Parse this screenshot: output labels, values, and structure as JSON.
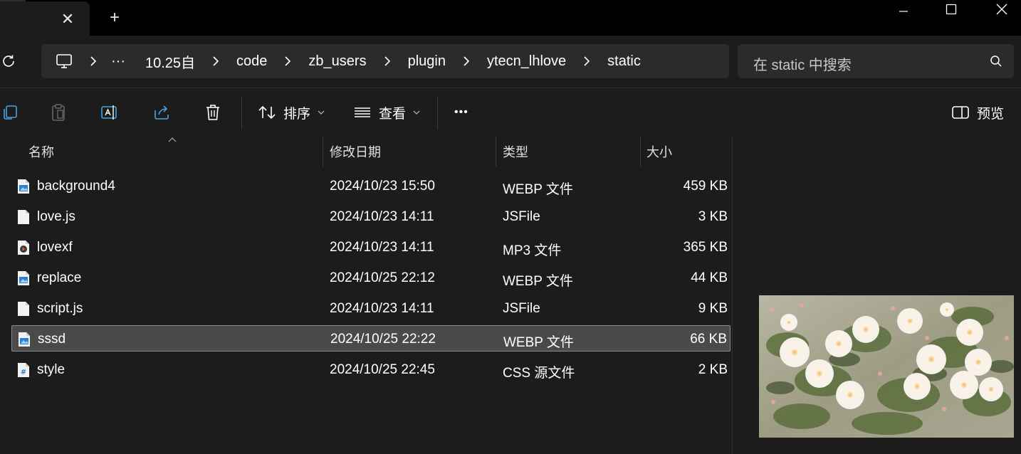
{
  "window": {
    "tab_close_glyph": "✕",
    "new_tab_glyph": "+",
    "minimize_glyph": "—",
    "close_glyph": "✕"
  },
  "breadcrumb": {
    "overflow": "···",
    "items": [
      "10.25自",
      "code",
      "zb_users",
      "plugin",
      "ytecn_lhlove",
      "static"
    ]
  },
  "search": {
    "placeholder": "在 static 中搜索"
  },
  "toolbar": {
    "sort_label": "排序",
    "view_label": "查看",
    "more_glyph": "•••",
    "preview_label": "预览"
  },
  "columns": {
    "name": "名称",
    "date": "修改日期",
    "type": "类型",
    "size": "大小"
  },
  "files": [
    {
      "name": "background4",
      "date": "2024/10/23 15:50",
      "type": "WEBP 文件",
      "size": "459 KB",
      "icon": "image-file-icon"
    },
    {
      "name": "love.js",
      "date": "2024/10/23 14:11",
      "type": "JSFile",
      "size": "3 KB",
      "icon": "blank-file-icon"
    },
    {
      "name": "lovexf",
      "date": "2024/10/23 14:11",
      "type": "MP3 文件",
      "size": "365 KB",
      "icon": "audio-file-icon"
    },
    {
      "name": "replace",
      "date": "2024/10/25 22:12",
      "type": "WEBP 文件",
      "size": "44 KB",
      "icon": "image-file-icon"
    },
    {
      "name": "script.js",
      "date": "2024/10/23 14:11",
      "type": "JSFile",
      "size": "9 KB",
      "icon": "blank-file-icon"
    },
    {
      "name": "sssd",
      "date": "2024/10/25 22:22",
      "type": "WEBP 文件",
      "size": "66 KB",
      "icon": "image-file-icon",
      "selected": true
    },
    {
      "name": "style",
      "date": "2024/10/25 22:45",
      "type": "CSS 源文件",
      "size": "2 KB",
      "icon": "css-file-icon"
    }
  ],
  "colors": {
    "background": "#1c1c1c",
    "titlebar": "#000000",
    "field": "#2b2b2b",
    "selection": "#4a4a4a",
    "accent": "#4aa3df"
  }
}
